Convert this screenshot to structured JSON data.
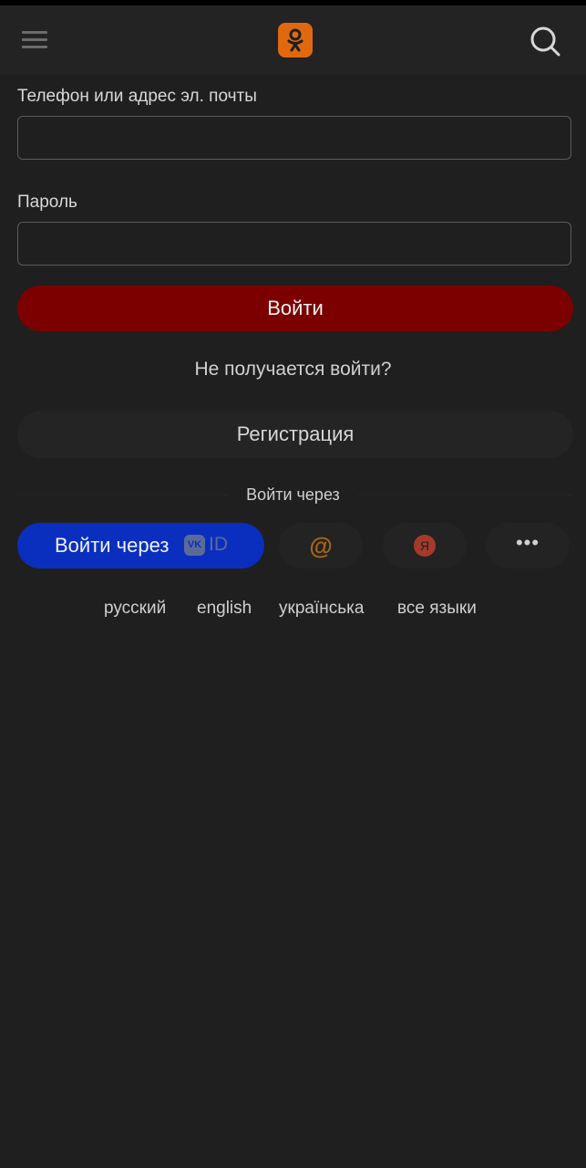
{
  "header": {
    "menu_icon": "hamburger-menu-icon",
    "logo_icon": "ok-logo-icon",
    "search_icon": "search-icon",
    "logo_color": "#e0690f"
  },
  "form": {
    "login_label": "Телефон или адрес эл. почты",
    "login_value": "",
    "password_label": "Пароль",
    "password_value": "",
    "submit_label": "Войти",
    "submit_color": "#7c0000",
    "trouble_link": "Не получается войти?",
    "register_label": "Регистрация"
  },
  "social": {
    "via_label": "Войти через",
    "vk_label": "Войти через",
    "vk_logo": "VK",
    "vk_id": "ID",
    "vk_color": "#0a2fbf",
    "mail_glyph": "@",
    "yandex_glyph": "Я",
    "more_glyph": "•••"
  },
  "languages": {
    "ru": "русский",
    "en": "english",
    "uk": "українська",
    "all": "все языки"
  }
}
